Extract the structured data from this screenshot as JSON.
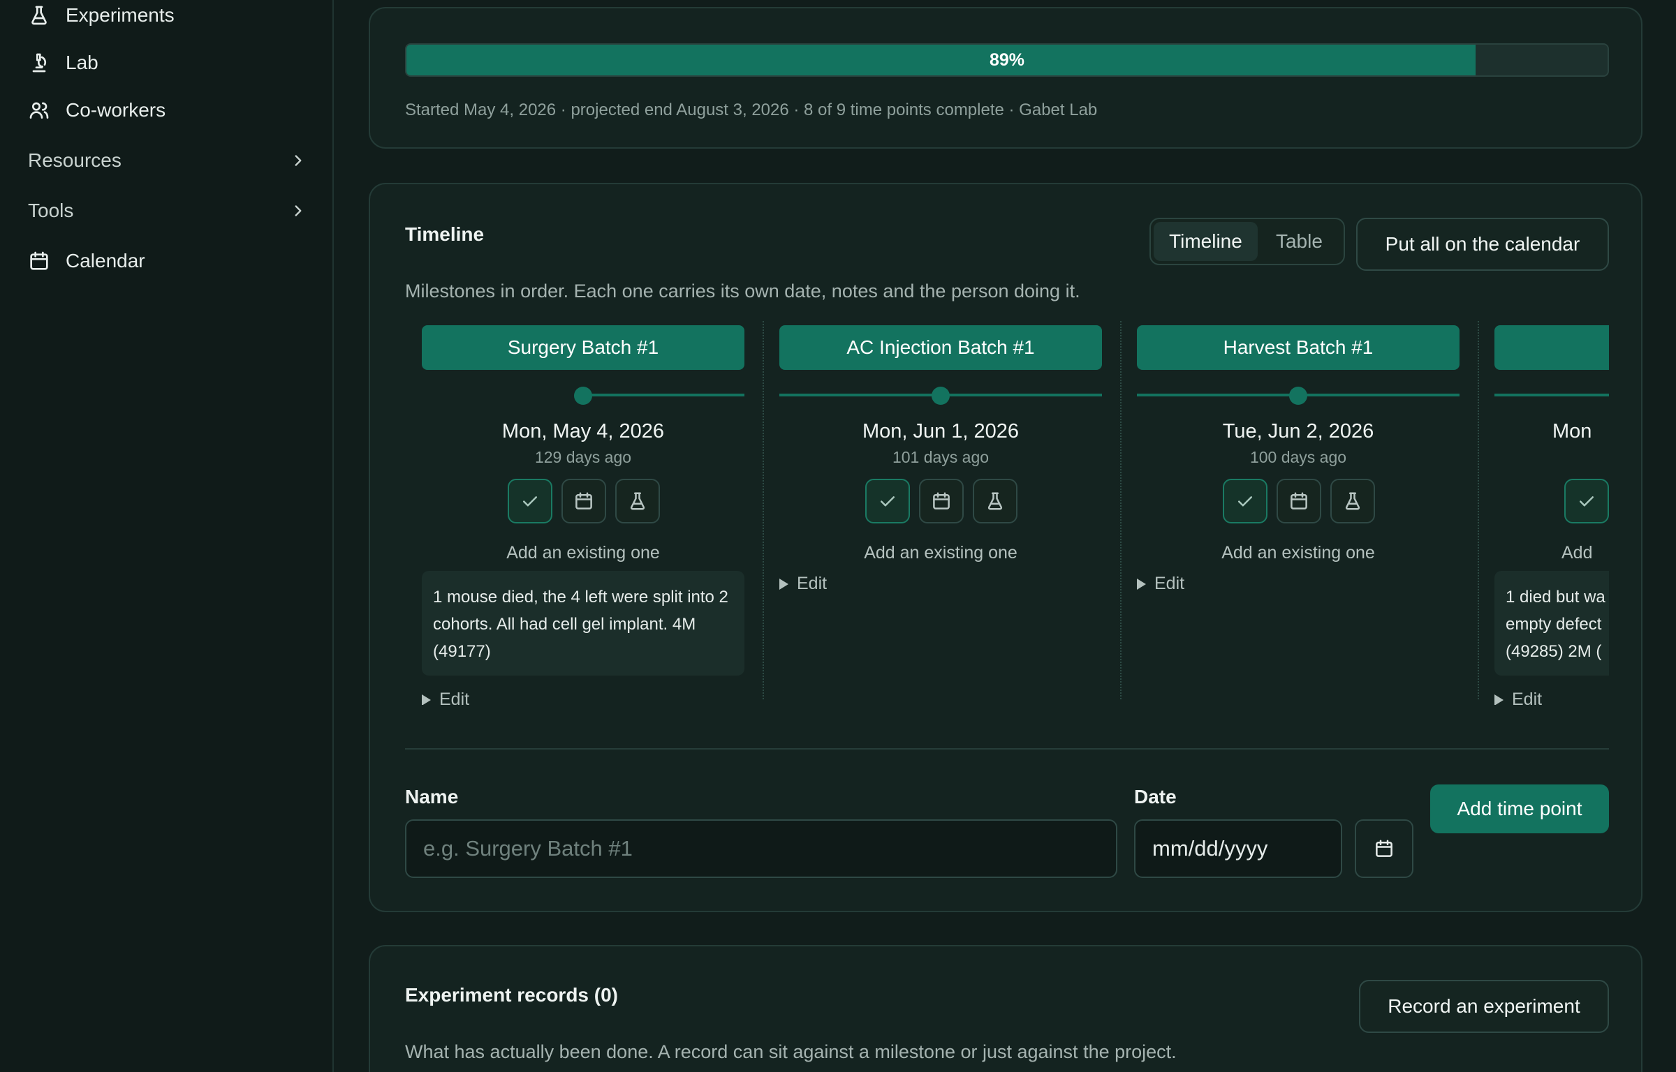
{
  "sidebar": {
    "items": [
      {
        "label": "Experiments",
        "icon": "flask-icon"
      },
      {
        "label": "Lab",
        "icon": "microscope-icon"
      },
      {
        "label": "Co-workers",
        "icon": "users-icon"
      }
    ],
    "groups": [
      {
        "label": "Resources",
        "icon": "chevron-right-icon"
      },
      {
        "label": "Tools",
        "icon": "chevron-right-icon"
      }
    ],
    "calendar": {
      "label": "Calendar",
      "icon": "calendar-icon"
    }
  },
  "progress": {
    "percent": 89,
    "label": "89%",
    "meta": "Started May 4, 2026 · projected end August 3, 2026 · 8 of 9 time points complete · Gabet Lab"
  },
  "timeline": {
    "title": "Timeline",
    "description": "Milestones in order. Each one carries its own date, notes and the person doing it.",
    "view_toggle": {
      "active": "Timeline",
      "inactive": "Table"
    },
    "calendar_button": "Put all on the calendar",
    "add_existing": "Add an existing one",
    "edit_label": "Edit",
    "milestones": [
      {
        "title": "Surgery Batch #1",
        "date": "Mon, May 4, 2026",
        "ago": "129 days ago",
        "note": "1 mouse died, the 4 left were split into 2 cohorts. All had cell gel implant. 4M (49177)"
      },
      {
        "title": "AC Injection Batch #1",
        "date": "Mon, Jun 1, 2026",
        "ago": "101 days ago",
        "note": ""
      },
      {
        "title": "Harvest Batch #1",
        "date": "Tue, Jun 2, 2026",
        "ago": "100 days ago",
        "note": ""
      },
      {
        "title": "",
        "date": "Mon",
        "ago": "",
        "add": "Add",
        "note": "1 died but wa empty defect (49285) 2M ("
      }
    ]
  },
  "add_form": {
    "name_label": "Name",
    "name_placeholder": "e.g. Surgery Batch #1",
    "date_label": "Date",
    "date_value": "mm/dd/yyyy",
    "submit": "Add time point"
  },
  "records": {
    "title": "Experiment records (0)",
    "button": "Record an experiment",
    "description": "What has actually been done. A record can sit against a milestone or just against the project."
  },
  "colors": {
    "accent": "#13735f",
    "background": "#111d1b",
    "card": "#142320"
  }
}
